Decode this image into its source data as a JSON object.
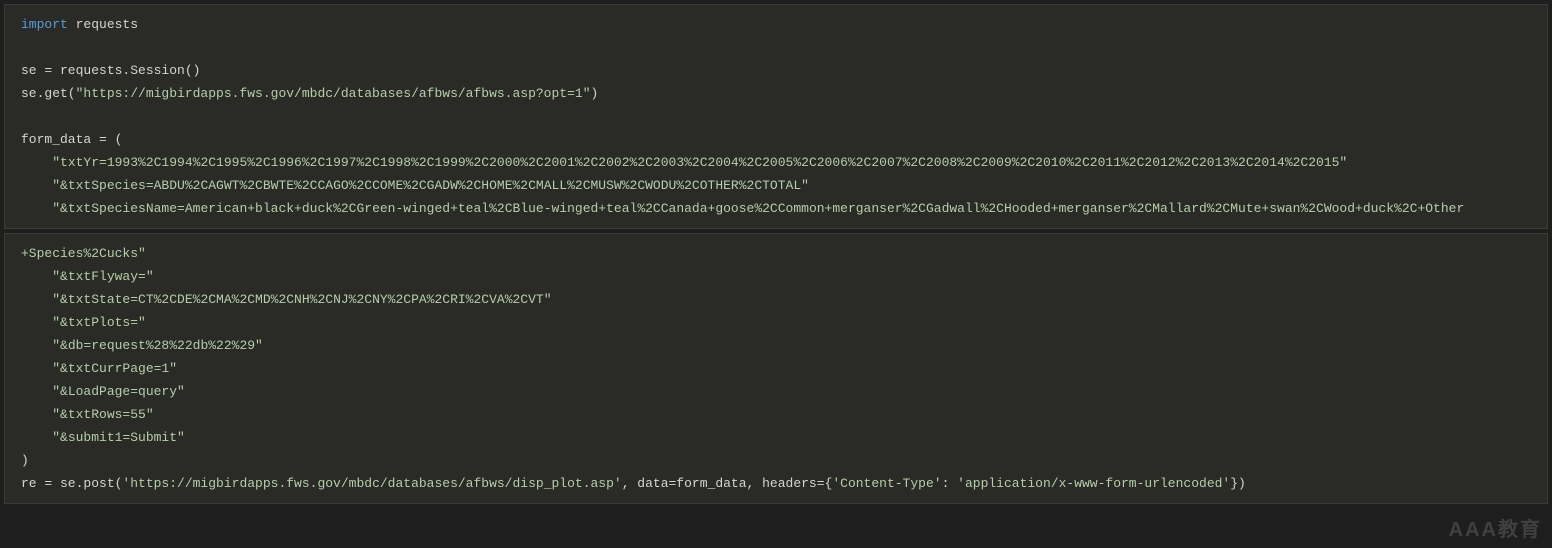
{
  "block1": {
    "l1_kw": "import",
    "l1_mod": " requests",
    "l2": "",
    "l3": "se = requests.Session()",
    "l4_pre": "se.get(",
    "l4_str": "\"https://migbirdapps.fws.gov/mbdc/databases/afbws/afbws.asp?opt=1\"",
    "l4_post": ")",
    "l5": "",
    "l6": "form_data = (",
    "l7_indent": "    ",
    "l7_str": "\"txtYr=1993%2C1994%2C1995%2C1996%2C1997%2C1998%2C1999%2C2000%2C2001%2C2002%2C2003%2C2004%2C2005%2C2006%2C2007%2C2008%2C2009%2C2010%2C2011%2C2012%2C2013%2C2014%2C2015\"",
    "l8_indent": "    ",
    "l8_str": "\"&txtSpecies=ABDU%2CAGWT%2CBWTE%2CCAGO%2CCOME%2CGADW%2CHOME%2CMALL%2CMUSW%2CWODU%2COTHER%2CTOTAL\"",
    "l9_indent": "    ",
    "l9_str": "\"&txtSpeciesName=American+black+duck%2CGreen-winged+teal%2CBlue-winged+teal%2CCanada+goose%2CCommon+merganser%2CGadwall%2CHooded+merganser%2CMallard%2CMute+swan%2CWood+duck%2C+Other"
  },
  "block2": {
    "l1_str": "+Species%2Cucks\"",
    "l2_indent": "    ",
    "l2_str": "\"&txtFlyway=\"",
    "l3_indent": "    ",
    "l3_str": "\"&txtState=CT%2CDE%2CMA%2CMD%2CNH%2CNJ%2CNY%2CPA%2CRI%2CVA%2CVT\"",
    "l4_indent": "    ",
    "l4_str": "\"&txtPlots=\"",
    "l5_indent": "    ",
    "l5_str": "\"&db=request%28%22db%22%29\"",
    "l6_indent": "    ",
    "l6_str": "\"&txtCurrPage=1\"",
    "l7_indent": "    ",
    "l7_str": "\"&LoadPage=query\"",
    "l8_indent": "    ",
    "l8_str": "\"&txtRows=55\"",
    "l9_indent": "    ",
    "l9_str": "\"&submit1=Submit\"",
    "l10": ")",
    "l11_pre": "re = se.post(",
    "l11_url": "'https://migbirdapps.fws.gov/mbdc/databases/afbws/disp_plot.asp'",
    "l11_mid1": ", data=form_data, headers={",
    "l11_k": "'Content-Type'",
    "l11_mid2": ": ",
    "l11_v": "'application/x-www-form-urlencoded'",
    "l11_post": "})"
  },
  "watermark": "AAA教育"
}
